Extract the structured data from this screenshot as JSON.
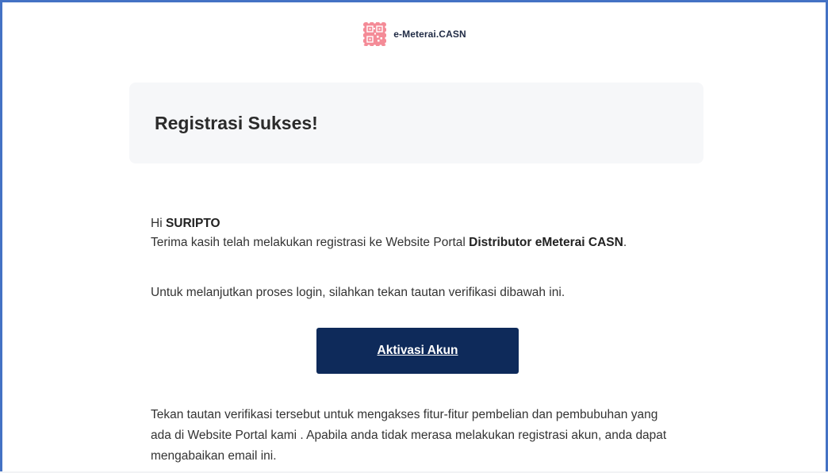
{
  "header": {
    "logo_icon": "emeterai-stamp-icon",
    "brand_name": "e-Meterai.CASN",
    "brand_color": "#f06a7a"
  },
  "banner": {
    "title": "Registrasi Sukses!"
  },
  "message": {
    "greeting_prefix": "Hi ",
    "user_name": "SURIPTO",
    "intro_text": "Terima kasih telah melakukan registrasi ke Website Portal ",
    "intro_bold": "Distributor eMeterai CASN",
    "intro_end": ".",
    "instruction": "Untuk melanjutkan proses login, silahkan tekan tautan verifikasi dibawah ini.",
    "footer": "Tekan tautan verifikasi tersebut untuk mengakses fitur-fitur pembelian dan pembubuhan yang ada di Website Portal kami . Apabila anda tidak merasa melakukan registrasi akun, anda dapat mengabaikan email ini."
  },
  "cta": {
    "label": "Aktivasi Akun",
    "color": "#0e2a5a"
  },
  "accent_border_color": "#4472c4"
}
